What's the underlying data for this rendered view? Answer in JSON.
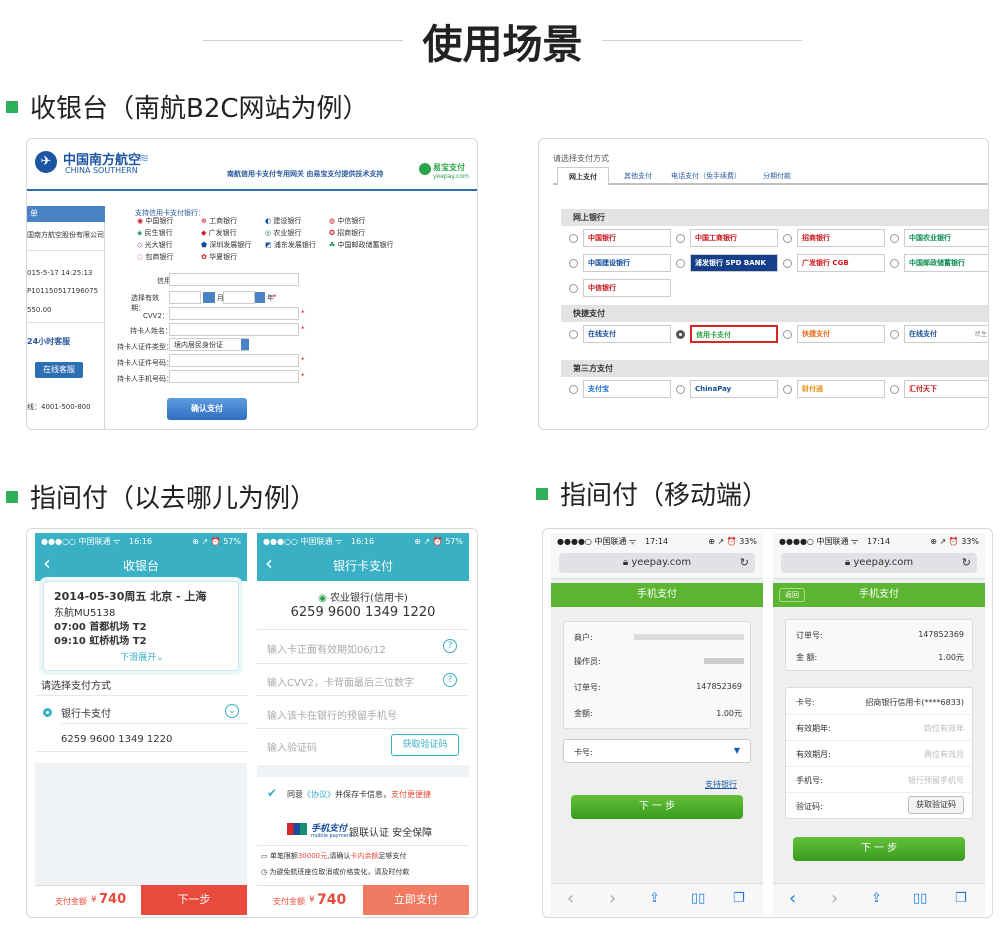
{
  "header": {
    "title": "使用场景"
  },
  "sections": {
    "s1": "收银台（南航B2C网站为例）",
    "s2": "指间付（以去哪儿为例）",
    "s3": "指间付（移动端）"
  },
  "csa": {
    "brand_cn": "中国南方航空",
    "brand_en": "CHINA SOUTHERN",
    "banner": "南航信用卡支付专用网关 由易宝支付提供技术支持",
    "yeepay_logo": "易宝支付",
    "yeepay_sub": "yeepay.com",
    "left_tab": "单",
    "left_company": "国南方航空股份有限公司",
    "left_time": "015-5-17 14:25:13",
    "left_order": "P101150517196075",
    "left_amount": "550.00",
    "left_service": "24小时客服",
    "online_button": "在线客服",
    "hotline": "线：4001-500-800",
    "bank_list_title": "支持信用卡支付银行：",
    "banks": [
      "中国银行",
      "工商银行",
      "建设银行",
      "中信银行",
      "民生银行",
      "广发银行",
      "农业银行",
      "招商银行",
      "光大银行",
      "深圳发展银行",
      "浦东发展银行",
      "中国邮政储蓄银行",
      "包商银行",
      "华夏银行"
    ],
    "field_card": "信用卡卡号：",
    "field_expiry": "选择有效期：",
    "month": "月",
    "year": "年",
    "required_mark": "*",
    "field_cvv": "CVV2：",
    "field_name": "持卡人姓名：",
    "field_idtype": "持卡人证件类型：",
    "idtype_value": "境内居民身份证",
    "field_idno": "持卡人证件号码：",
    "field_phone": "持卡人手机号码：",
    "submit": "确认支付"
  },
  "payments": {
    "title": "请选择支付方式",
    "tabs": [
      "网上支付",
      "其他支付",
      "电话支付（免手续费）",
      "分期付款"
    ],
    "cat_online": "网上银行",
    "online_banks": [
      "中国银行",
      "中国工商银行",
      "招商银行",
      "中国农业银行",
      "中国建设银行",
      "浦发银行 SPD BANK",
      "广发银行 CGB",
      "中国邮政储蓄银行",
      "中信银行"
    ],
    "cat_quick": "快捷支付",
    "quick": [
      "在线支付",
      "信用卡支付",
      "快捷支付",
      "在线支付"
    ],
    "quick_tail": "民生",
    "cat_third": "第三方支付",
    "third": [
      "支付宝",
      "ChinaPay",
      "财付通",
      "汇付天下"
    ]
  },
  "qunar1": {
    "status_left": "●●●○○ 中国联通 ᯤ",
    "time": "16:16",
    "status_right": "⊕ ↗ ⏰ 57%",
    "title": "收银台",
    "trip_date": "2014-05-30周五 北京 - 上海",
    "flight": "东航MU5138",
    "dep": "07:00 首都机场 T2",
    "arr": "09:10 虹桥机场 T2",
    "expand": "下滑展开",
    "pay_method_title": "请选择支付方式",
    "method": "银行卡支付",
    "card_no": "6259 9600 1349 1220",
    "total_label": "支付金额",
    "total_currency": "¥",
    "total_amount": "740",
    "next": "下一步"
  },
  "qunar2": {
    "status_left": "●●●○○ 中国联通 ᯤ",
    "time": "16:16",
    "status_right": "⊕ ↗ ⏰ 57%",
    "title": "银行卡支付",
    "bank_name": "农业银行(信用卡)",
    "card_no": "6259 9600 1349 1220",
    "ph_expiry": "输入卡正面有效期如06/12",
    "ph_cvv": "输入CVV2，卡背面最后三位数字",
    "ph_phone": "输入该卡在银行的预留手机号",
    "ph_code": "输入验证码",
    "get_code": "获取验证码",
    "agree_pre": "同意",
    "agree_link": "《协议》",
    "agree_mid": "并保存卡信息，",
    "agree_red": "支付更便捷",
    "unionpay": "手机支付",
    "unionpay_en": "mobile payment",
    "cert": "银联认证 安全保障",
    "limit_pre": "单笔限额",
    "limit_amt": "30000元",
    "limit_mid": ",请确认",
    "limit_red": "卡内余额",
    "limit_post": "足够支付",
    "note": "为避免航班座位取消或价格变化，请及时付款",
    "total_label": "支付金额",
    "total_currency": "¥",
    "total_amount": "740",
    "pay_now": "立即支付"
  },
  "yeepay1": {
    "status_left": "●●●●○ 中国联通 ᯤ",
    "time": "17:14",
    "status_right": "⊕ ↗ ⏰ 33%",
    "url": "yeepay.com",
    "title": "手机支付",
    "merchant_label": "商户:",
    "operator_label": "操作员:",
    "order_label": "订单号:",
    "order_value": "147852369",
    "amount_label": "金额:",
    "amount_value": "1.00元",
    "card_label": "卡号:",
    "support_banks": "支持银行",
    "next": "下 一 步"
  },
  "yeepay2": {
    "status_left": "●●●●○ 中国联通 ᯤ",
    "time": "17:14",
    "status_right": "⊕ ↗ ⏰ 33%",
    "url": "yeepay.com",
    "back": "返回",
    "title": "手机支付",
    "order_label": "订单号:",
    "order_value": "147852369",
    "amount_label": "金 额:",
    "amount_value": "1.00元",
    "card_label": "卡号:",
    "card_value": "招商银行信用卡(****6833)",
    "valid_year_label": "有效期年:",
    "valid_year_ph": "四位有效年",
    "valid_month_label": "有效期月:",
    "valid_month_ph": "两位有效月",
    "phone_label": "手机号:",
    "phone_ph": "银行预留手机号",
    "code_label": "验证码:",
    "get_code": "获取验证码",
    "next": "下 一 步"
  },
  "colors": {
    "section_square": "#2fae5c",
    "qunar_teal": "#3ab0c4",
    "qunar_red": "#e84a3c",
    "yeepay_green": "#5cb531"
  }
}
